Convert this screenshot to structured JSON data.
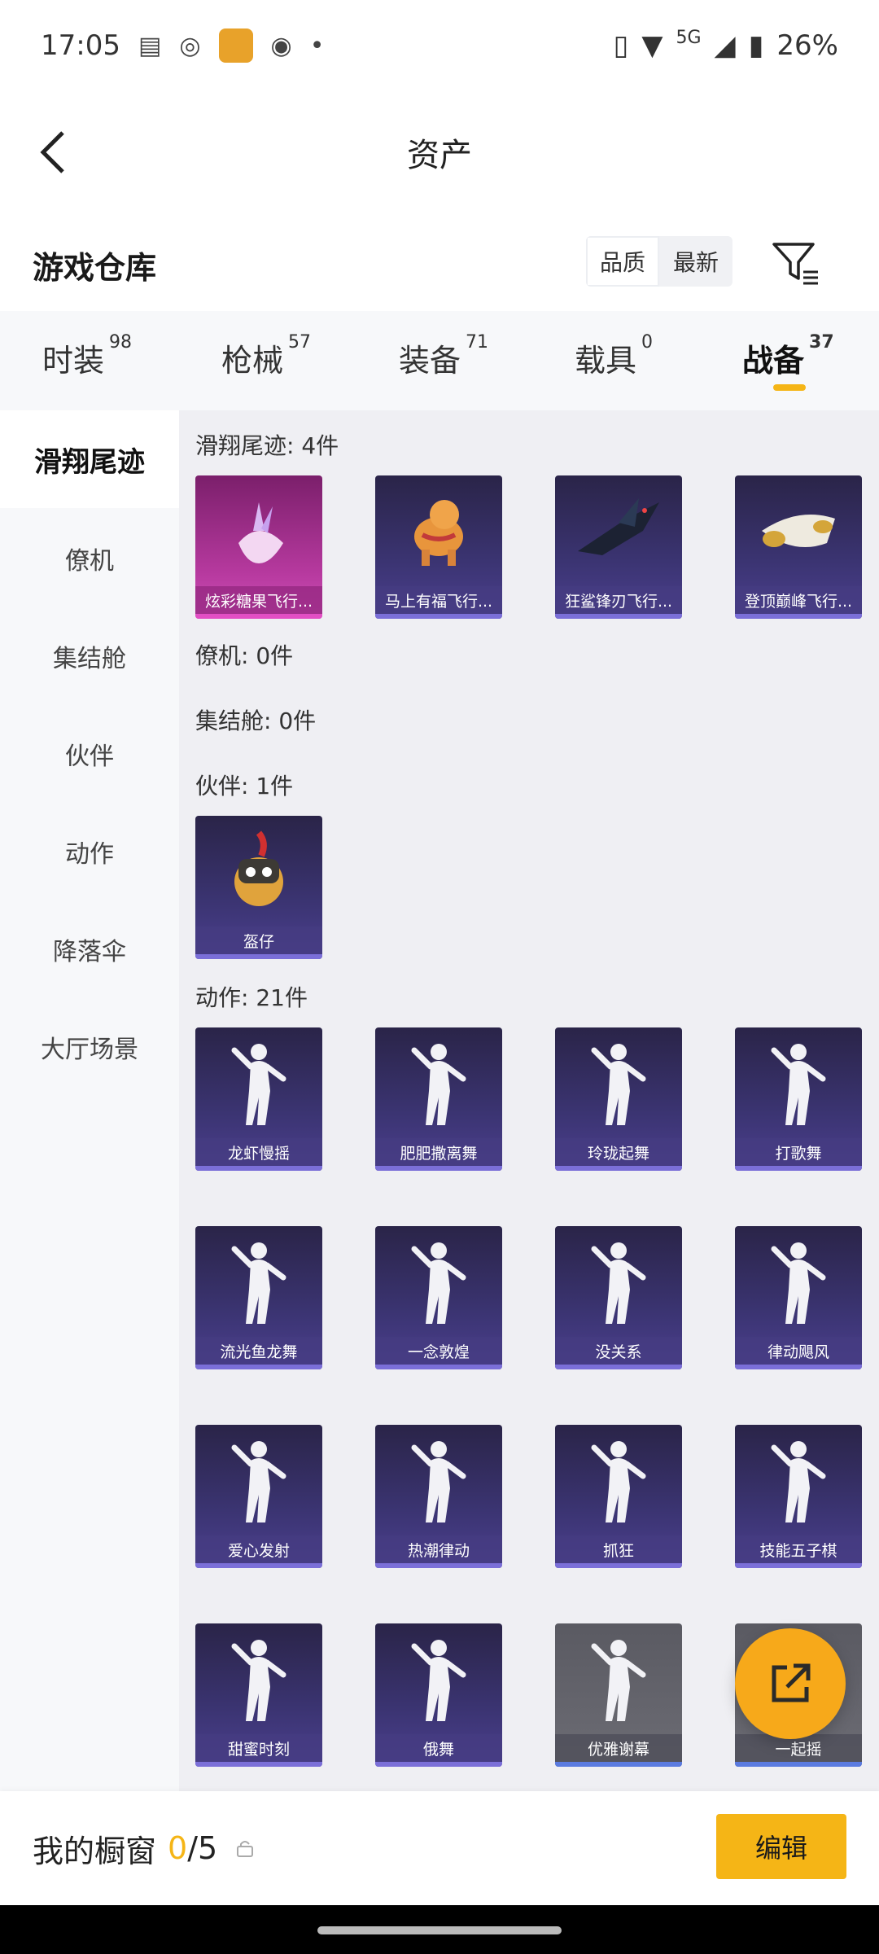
{
  "status_bar": {
    "time": "17:05",
    "battery": "26%",
    "network": "5G"
  },
  "nav": {
    "title": "资产"
  },
  "warehouse": {
    "title": "游戏仓库",
    "sort_quality": "品质",
    "sort_latest": "最新"
  },
  "tabs": [
    {
      "label": "时装",
      "count": "98"
    },
    {
      "label": "枪械",
      "count": "57"
    },
    {
      "label": "装备",
      "count": "71"
    },
    {
      "label": "载具",
      "count": "0"
    },
    {
      "label": "战备",
      "count": "37"
    }
  ],
  "sidebar": [
    {
      "label": "滑翔尾迹"
    },
    {
      "label": "僚机"
    },
    {
      "label": "集结舱"
    },
    {
      "label": "伙伴"
    },
    {
      "label": "动作"
    },
    {
      "label": "降落伞"
    },
    {
      "label": "大厅场景"
    }
  ],
  "sections": {
    "glide": {
      "header": "滑翔尾迹: 4件",
      "items": [
        {
          "label": "炫彩糖果飞行..."
        },
        {
          "label": "马上有福飞行..."
        },
        {
          "label": "狂鲨锋刃飞行..."
        },
        {
          "label": "登顶巅峰飞行..."
        }
      ]
    },
    "wingman": {
      "header": "僚机: 0件"
    },
    "pod": {
      "header": "集结舱: 0件"
    },
    "partner": {
      "header": "伙伴: 1件",
      "items": [
        {
          "label": "盔仔"
        }
      ]
    },
    "emote": {
      "header": "动作: 21件",
      "items": [
        {
          "label": "龙虾慢摇"
        },
        {
          "label": "肥肥撒离舞"
        },
        {
          "label": "玲珑起舞"
        },
        {
          "label": "打歌舞"
        },
        {
          "label": "流光鱼龙舞"
        },
        {
          "label": "一念敦煌"
        },
        {
          "label": "没关系"
        },
        {
          "label": "律动飓风"
        },
        {
          "label": "爱心发射"
        },
        {
          "label": "热潮律动"
        },
        {
          "label": "抓狂"
        },
        {
          "label": "技能五子棋"
        },
        {
          "label": "甜蜜时刻"
        },
        {
          "label": "俄舞"
        },
        {
          "label": "优雅谢幕"
        },
        {
          "label": "一起摇"
        }
      ]
    }
  },
  "bottom": {
    "label": "我的橱窗",
    "count_num": "0",
    "count_total": "/5",
    "edit": "编辑"
  },
  "colors": {
    "accent": "#f5b516",
    "card_bg": "#3b3472",
    "card_pink": "#b83aa0"
  }
}
